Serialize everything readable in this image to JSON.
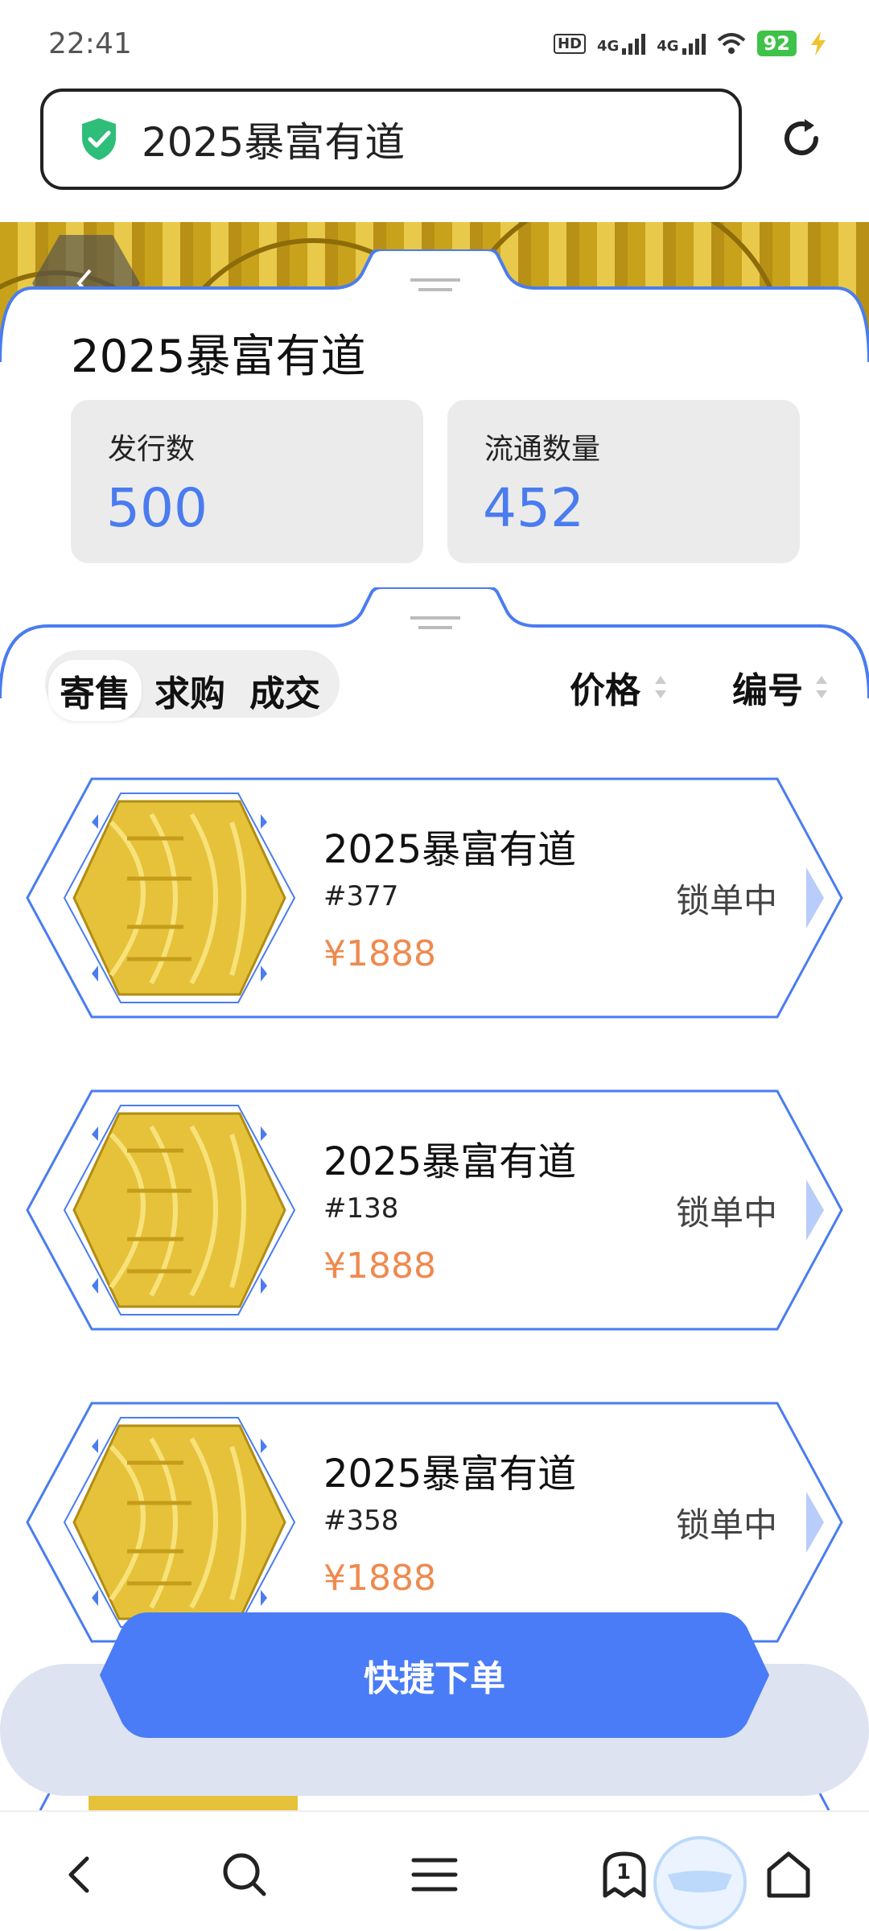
{
  "status_bar": {
    "time": "22:41",
    "battery": "92",
    "hd": "HD",
    "net1": "4G",
    "net2": "4G"
  },
  "url_bar": {
    "text": "2025暴富有道"
  },
  "detail": {
    "title": "2025暴富有道",
    "stats": [
      {
        "label": "发行数",
        "value": "500"
      },
      {
        "label": "流通数量",
        "value": "452"
      }
    ]
  },
  "tabs": [
    {
      "label": "寄售",
      "active": true
    },
    {
      "label": "求购",
      "active": false
    },
    {
      "label": "成交",
      "active": false
    }
  ],
  "sort": {
    "price_label": "价格",
    "number_label": "编号"
  },
  "listings": [
    {
      "name": "2025暴富有道",
      "number": "#377",
      "price": "¥1888",
      "status": "锁单中"
    },
    {
      "name": "2025暴富有道",
      "number": "#138",
      "price": "¥1888",
      "status": "锁单中"
    },
    {
      "name": "2025暴富有道",
      "number": "#358",
      "price": "¥1888",
      "status": "锁单中"
    }
  ],
  "quick_order": {
    "label": "快捷下单"
  },
  "bottom_nav": {
    "tab_count": "1"
  },
  "colors": {
    "accent": "#4a7cf0",
    "price": "#ee8a4e",
    "gold": "#e6c23a"
  }
}
